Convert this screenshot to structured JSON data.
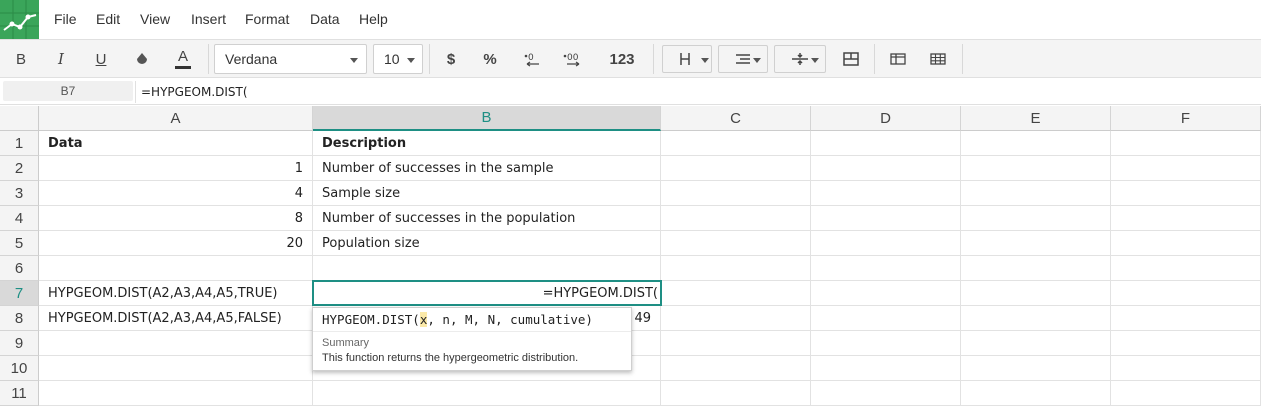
{
  "menu": [
    "File",
    "Edit",
    "View",
    "Insert",
    "Format",
    "Data",
    "Help"
  ],
  "toolbar": {
    "bold": "B",
    "italic": "I",
    "underline": "U",
    "font_name": "Verdana",
    "font_size": "10",
    "currency": "$",
    "percent": "%",
    "decrease_decimals": ".0",
    "increase_decimals": ".00",
    "number_format": "123"
  },
  "formula_bar": {
    "cell_ref": "B7",
    "formula": "=HYPGEOM.DIST("
  },
  "columns": [
    "A",
    "B",
    "C",
    "D",
    "E",
    "F"
  ],
  "active_column": "B",
  "rows": [
    "1",
    "2",
    "3",
    "4",
    "5",
    "6",
    "7",
    "8",
    "9",
    "10",
    "11"
  ],
  "active_row": "7",
  "cells": {
    "A1": "Data",
    "B1": "Description",
    "A2": "1",
    "B2": "Number of successes in the sample",
    "A3": "4",
    "B3": "Sample size",
    "A4": "8",
    "B4": "Number of successes in the population",
    "A5": "20",
    "B5": "Population size",
    "A7": "HYPGEOM.DIST(A2,A3,A4,A5,TRUE)",
    "B7": "=HYPGEOM.DIST(",
    "A8": "HYPGEOM.DIST(A2,A3,A4,A5,FALSE)",
    "B8_partial": "49"
  },
  "autocomplete": {
    "fn_prefix": "HYPGEOM.DIST(",
    "active_arg": "x",
    "rest_args": ", n, M, N, cumulative)",
    "summary_title": "Summary",
    "summary": "This function returns the hypergeometric distribution."
  },
  "colors": {
    "accent": "#1e8f84",
    "logo": "#3aa55a"
  }
}
